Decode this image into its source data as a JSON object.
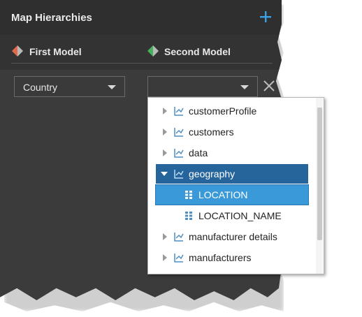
{
  "header": {
    "title": "Map Hierarchies",
    "add_icon": "plus-icon",
    "accent": "#3aa0e6"
  },
  "models": {
    "first": {
      "label": "First Model",
      "icon": "model-icon",
      "color": "#e2694a"
    },
    "second": {
      "label": "Second Model",
      "icon": "model-icon",
      "color": "#45b35a"
    }
  },
  "mapping": {
    "first_value": "Country",
    "second_value": "",
    "clear_icon": "close-icon"
  },
  "tree": {
    "items": [
      {
        "label": "customerProfile",
        "type": "hierarchy",
        "state": "collapsed"
      },
      {
        "label": "customers",
        "type": "hierarchy",
        "state": "collapsed"
      },
      {
        "label": "data",
        "type": "hierarchy",
        "state": "collapsed"
      },
      {
        "label": "geography",
        "type": "hierarchy",
        "state": "expanded"
      },
      {
        "label": "LOCATION",
        "type": "level",
        "state": "selected"
      },
      {
        "label": "LOCATION_NAME",
        "type": "level",
        "state": "normal"
      },
      {
        "label": "manufacturer details",
        "type": "hierarchy",
        "state": "collapsed"
      },
      {
        "label": "manufacturers",
        "type": "hierarchy",
        "state": "collapsed"
      }
    ],
    "colors": {
      "selected_parent": "#26659c",
      "selected_child": "#3a9ad9"
    }
  }
}
